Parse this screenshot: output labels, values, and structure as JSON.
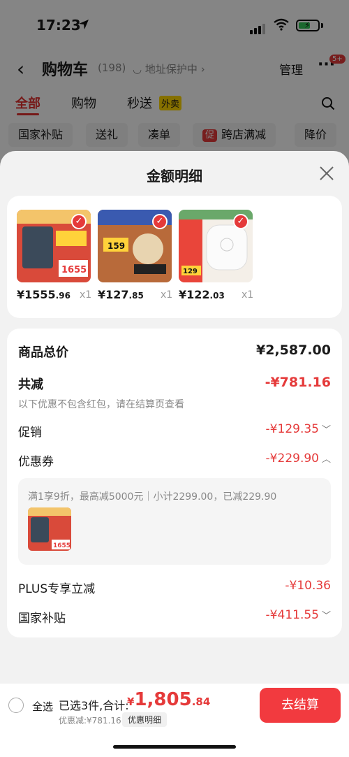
{
  "status_bar": {
    "time": "17:23"
  },
  "header": {
    "title": "购物车",
    "count": "(198)",
    "address_protect": "地址保护中",
    "manage": "管理",
    "more_badge": "5+"
  },
  "tabs": [
    {
      "label": "全部"
    },
    {
      "label": "购物"
    },
    {
      "label": "秒送"
    }
  ],
  "waimai": "外卖",
  "chips": [
    {
      "label": "国家补贴"
    },
    {
      "label": "送礼"
    },
    {
      "label": "凑单"
    },
    {
      "label": "跨店满减",
      "badge": "促"
    },
    {
      "label": "降价"
    }
  ],
  "sheet": {
    "title": "金额明细",
    "products": [
      {
        "price_int": "¥1555",
        "price_dec": ".96",
        "qty": "x1",
        "thumb_text": "1655"
      },
      {
        "price_int": "¥127",
        "price_dec": ".85",
        "qty": "x1",
        "thumb_text": "159"
      },
      {
        "price_int": "¥122",
        "price_dec": ".03",
        "qty": "x1",
        "thumb_text": "129"
      }
    ],
    "summary": {
      "total_label": "商品总价",
      "total_value": "¥2,587.00",
      "reduce_label": "共减",
      "reduce_value": "-¥781.16",
      "note": "以下优惠不包含红包，请在结算页查看",
      "promo_label": "促销",
      "promo_value": "-¥129.35",
      "coupon_label": "优惠券",
      "coupon_value": "-¥229.90",
      "coupon_detail": "满1享9折，最高减5000元｜小计2299.00，已减229.90",
      "coupon_thumb_text": "1655",
      "plus_label": "PLUS专享立减",
      "plus_value": "-¥10.36",
      "subsidy_label": "国家补贴",
      "subsidy_value": "-¥411.55"
    }
  },
  "bottom": {
    "select_all": "全选",
    "selected": "已选3件,合计:",
    "currency": "¥",
    "total_int": "1,805",
    "total_dec": ".84",
    "discount": "优惠减:¥781.16",
    "detail_button": "优惠明细",
    "checkout": "去结算"
  },
  "colors": {
    "accent": "#e53a3a",
    "checkout": "#f23a3f",
    "waimai": "#ffd600"
  }
}
